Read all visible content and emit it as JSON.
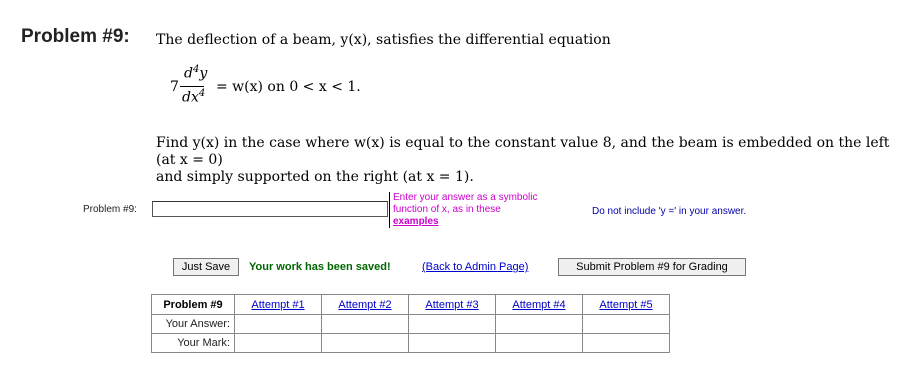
{
  "problem": {
    "title": "Problem #9:",
    "intro": "The deflection of a beam, y(x), satisfies the differential equation",
    "equation": {
      "coefficient": "7",
      "numerator": "d",
      "numerator_sup": "4",
      "numerator_var": "y",
      "denominator": "dx",
      "denominator_sup": "4",
      "rhs": "= w(x)   on 0 < x < 1."
    },
    "find_text_1": "Find y(x) in the case where w(x) is equal to the constant value 8, and the beam is embedded on the left (at x = 0)",
    "find_text_2": "and simply supported on the right (at x = 1)."
  },
  "answer": {
    "label": "Problem #9:",
    "value": "",
    "hint_line_1": "Enter your answer as a symbolic",
    "hint_line_2": "function of x, as in these",
    "hint_link": "examples",
    "format_note": "Do not include 'y =' in your answer."
  },
  "actions": {
    "just_save": "Just Save",
    "saved_message": "Your work has been saved!",
    "admin_link": "(Back to Admin Page)",
    "submit": "Submit Problem #9 for Grading"
  },
  "attempts": {
    "header": "Problem #9",
    "columns": [
      "Attempt #1",
      "Attempt #2",
      "Attempt #3",
      "Attempt #4",
      "Attempt #5"
    ],
    "row_labels": [
      "Your Answer:",
      "Your Mark:"
    ]
  }
}
